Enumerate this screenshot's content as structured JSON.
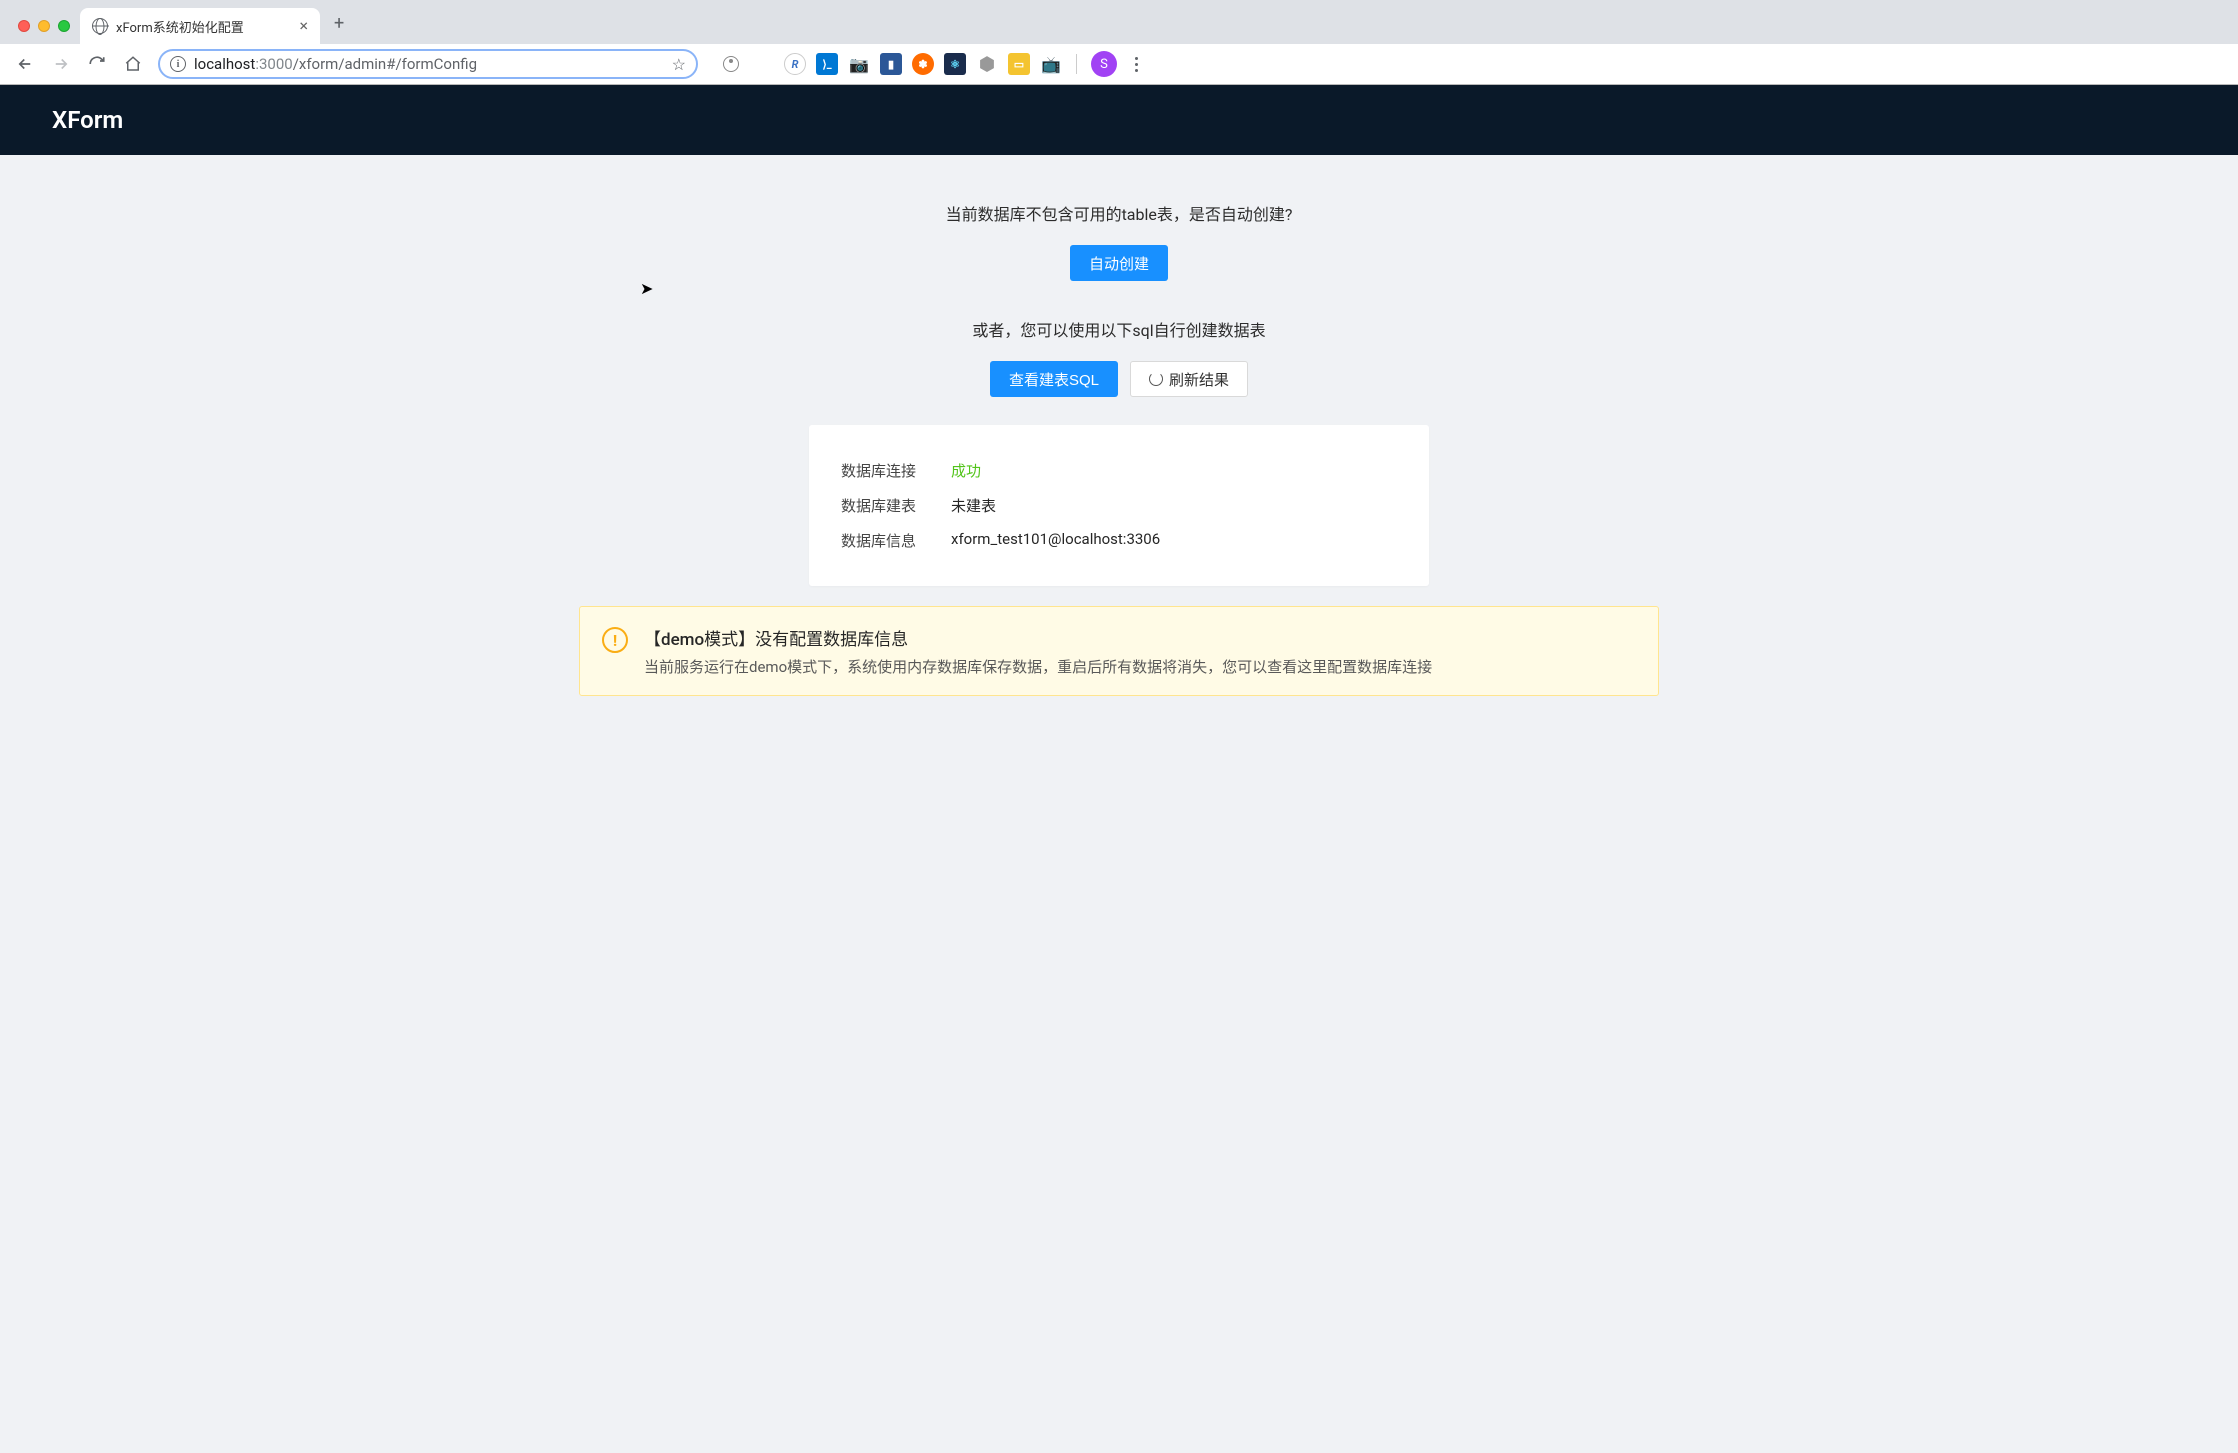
{
  "browser": {
    "tab_title": "xForm系统初始化配置",
    "url_host_pre": "localhost",
    "url_host_post": ":3000",
    "url_path": "/xform/admin#/formConfig",
    "avatar_letter": "S"
  },
  "header": {
    "app_name": "XForm"
  },
  "main": {
    "prompt": "当前数据库不包含可用的table表，是否自动创建?",
    "auto_create_btn": "自动创建",
    "alt_prompt": "或者，您可以使用以下sql自行创建数据表",
    "view_sql_btn": "查看建表SQL",
    "refresh_btn": "刷新结果"
  },
  "status": {
    "conn_label": "数据库连接",
    "conn_value": "成功",
    "table_label": "数据库建表",
    "table_value": "未建表",
    "info_label": "数据库信息",
    "info_value": "xform_test101@localhost:3306"
  },
  "alert": {
    "title": "【demo模式】没有配置数据库信息",
    "desc": "当前服务运行在demo模式下，系统使用内存数据库保存数据，重启后所有数据将消失，您可以查看这里配置数据库连接"
  },
  "ext_colors": {
    "e1": "#e8e8e8",
    "e2": "#6b2e8f",
    "e3": "#3971c4",
    "e4": "#0078d4",
    "e5": "#5f6368",
    "e6": "#2b5797",
    "e7": "#ff6b00",
    "e8": "#1a2c4c",
    "e9": "#777",
    "e10": "#f4c430",
    "e11": "#d67b4f"
  }
}
